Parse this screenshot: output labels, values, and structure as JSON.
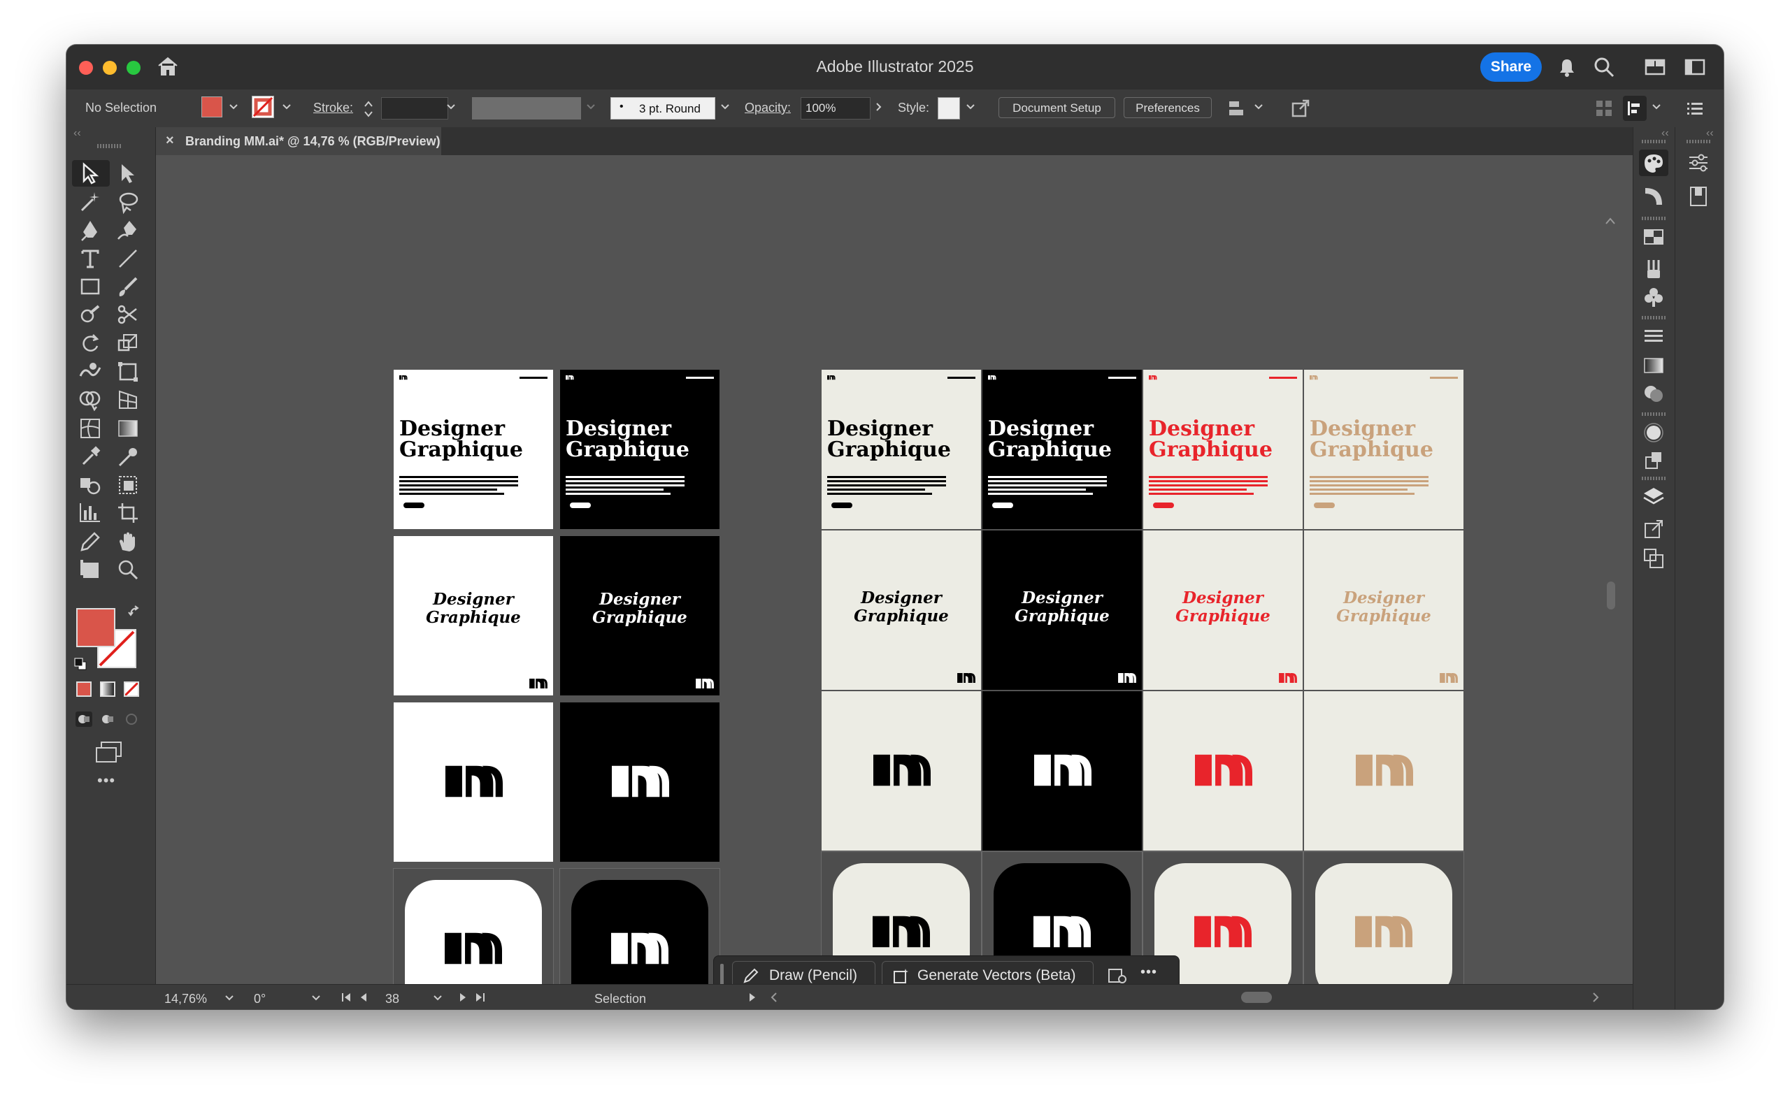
{
  "window": {
    "title": "Adobe Illustrator 2025",
    "share_label": "Share"
  },
  "control_bar": {
    "selection_status": "No Selection",
    "stroke_label": "Stroke:",
    "brush_label": "3 pt. Round",
    "opacity_label": "Opacity:",
    "opacity_value": "100%",
    "style_label": "Style:",
    "document_setup_label": "Document Setup",
    "preferences_label": "Preferences",
    "fill_color": "#d9554a"
  },
  "document_tab": {
    "close_glyph": "×",
    "title": "Branding MM.ai* @ 14,76 % (RGB/Preview)"
  },
  "status_bar": {
    "zoom": "14,76%",
    "rotation": "0°",
    "artboard_number": "38",
    "tool_name": "Selection"
  },
  "context_bar": {
    "draw_label": "Draw (Pencil)",
    "generate_label": "Generate Vectors (Beta)",
    "more_glyph": "•••"
  },
  "artwork": {
    "headline_line1": "Designer",
    "headline_line2": "Graphique",
    "colors": {
      "red": "#e8242b",
      "tan": "#c9a27c",
      "cream": "#ecece4",
      "black": "#000000",
      "white": "#ffffff"
    }
  },
  "tools_more": "•••"
}
